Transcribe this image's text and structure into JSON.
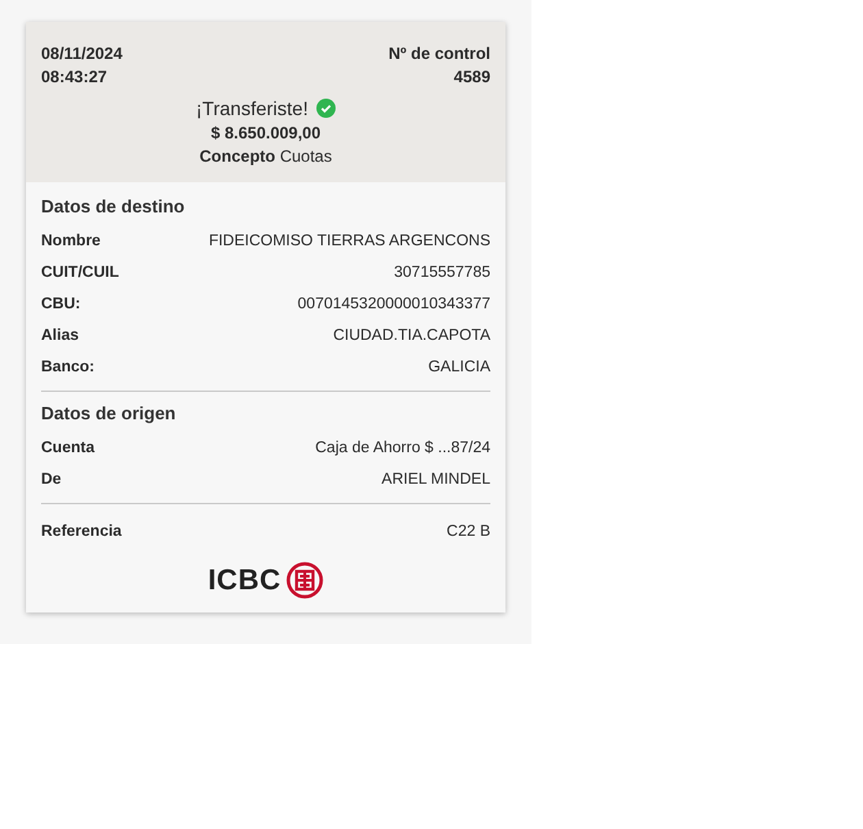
{
  "header": {
    "date": "08/11/2024",
    "time": "08:43:27",
    "control_label": "Nº de control",
    "control_number": "4589",
    "status": "¡Transferiste!",
    "amount": "$ 8.650.009,00",
    "concept_label": "Concepto",
    "concept_value": "Cuotas"
  },
  "sections": [
    {
      "title": "Datos de destino",
      "rows": [
        {
          "label": "Nombre",
          "value": "FIDEICOMISO TIERRAS ARGENCONS"
        },
        {
          "label": "CUIT/CUIL",
          "value": "30715557785"
        },
        {
          "label": "CBU:",
          "value": "0070145320000010343377"
        },
        {
          "label": "Alias",
          "value": "CIUDAD.TIA.CAPOTA"
        },
        {
          "label": "Banco:",
          "value": "GALICIA"
        }
      ]
    },
    {
      "title": "Datos de origen",
      "rows": [
        {
          "label": "Cuenta",
          "value": "Caja de Ahorro $ ...87/24"
        },
        {
          "label": "De",
          "value": "ARIEL MINDEL"
        }
      ]
    },
    {
      "rows": [
        {
          "label": "Referencia",
          "value": "C22 B"
        }
      ]
    }
  ],
  "logo": {
    "text": "ICBC"
  }
}
